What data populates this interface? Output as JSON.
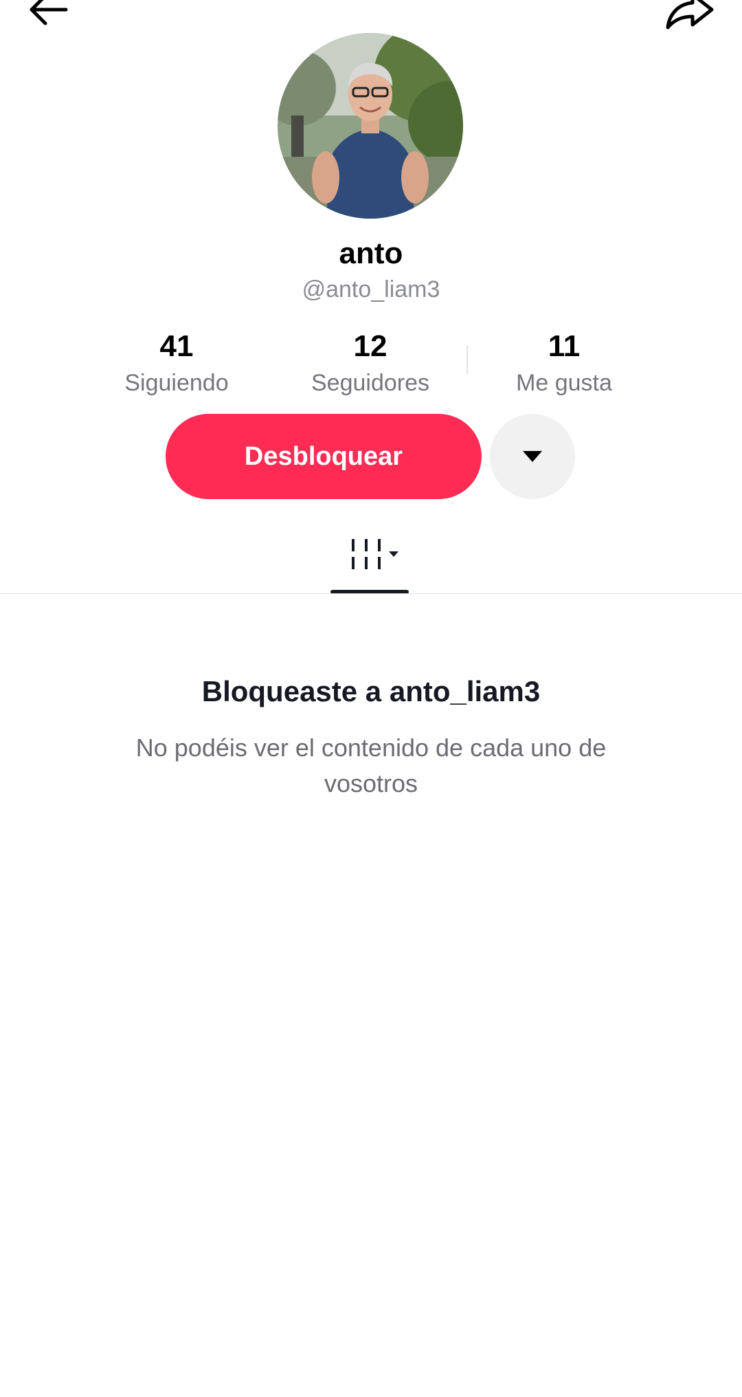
{
  "header": {
    "back_icon": "arrow-left-icon",
    "share_icon": "share-arrow-icon"
  },
  "profile": {
    "avatar": "profile-photo",
    "display_name": "anto",
    "username": "@anto_liam3"
  },
  "stats": [
    {
      "value": "41",
      "label": "Siguiendo"
    },
    {
      "value": "12",
      "label": "Seguidores"
    },
    {
      "value": "11",
      "label": "Me gusta"
    }
  ],
  "actions": {
    "unblock_label": "Desbloquear",
    "more_icon": "caret-down-icon"
  },
  "tabs": {
    "videos_icon": "grid-icon",
    "dropdown_icon": "caret-down-icon"
  },
  "blocked": {
    "title": "Bloqueaste a anto_liam3",
    "description": "No podéis ver el contenido de cada uno de vosotros"
  },
  "colors": {
    "accent": "#fe2c55",
    "secondary_button": "#f1f1f2",
    "muted_text": "#8a8b91"
  }
}
